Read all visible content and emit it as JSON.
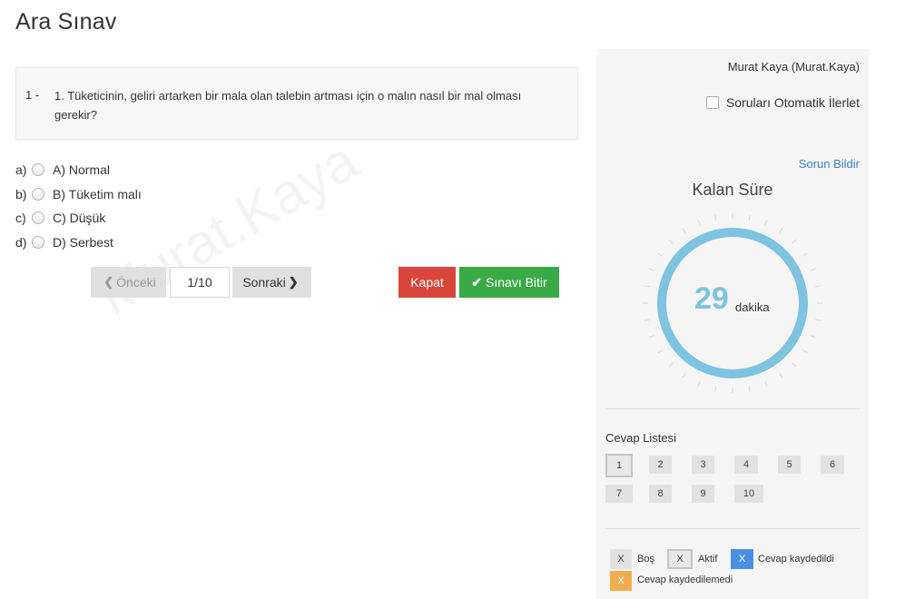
{
  "page": {
    "title": "Ara Sınav",
    "watermark": "Murat.Kaya"
  },
  "question": {
    "number": "1 -",
    "text": "1. Tüketicinin, geliri artarken bir mala olan talebin artması için o malın nasıl bir mal olması gerekir?",
    "options": [
      {
        "letter": "a)",
        "text": "A) Normal"
      },
      {
        "letter": "b)",
        "text": "B) Tüketim malı"
      },
      {
        "letter": "c)",
        "text": "C) Düşük"
      },
      {
        "letter": "d)",
        "text": "D) Serbest"
      }
    ]
  },
  "navigation": {
    "prev_label": "Önceki",
    "page_indicator": "1/10",
    "next_label": "Sonraki",
    "close_label": "Kapat",
    "finish_label": "Sınavı Bitir"
  },
  "sidebar": {
    "user": "Murat Kaya (Murat.Kaya)",
    "auto_advance_label": "Soruları Otomatik İlerlet",
    "report_label": "Sorun Bildir",
    "timer_label": "Kalan Süre",
    "timer_value": "29",
    "timer_unit": "dakika",
    "timer_color": "#7ec3e0",
    "answers_title": "Cevap Listesi",
    "answers": [
      "1",
      "2",
      "3",
      "4",
      "5",
      "6",
      "7",
      "8",
      "9",
      "10"
    ],
    "legend": {
      "empty": {
        "mark": "X",
        "label": "Boş",
        "color": "#e2e2e2"
      },
      "active": {
        "mark": "X",
        "label": "Aktif",
        "color": "#e8e8e8"
      },
      "saved": {
        "mark": "X",
        "label": "Cevap kaydedildi",
        "color": "#4a90e2"
      },
      "unsaved": {
        "mark": "X",
        "label": "Cevap kaydedilemedi",
        "color": "#f0ad4e"
      }
    }
  },
  "colors": {
    "close": "#d9453a",
    "finish": "#3aaa46",
    "link": "#3a7fbf"
  }
}
